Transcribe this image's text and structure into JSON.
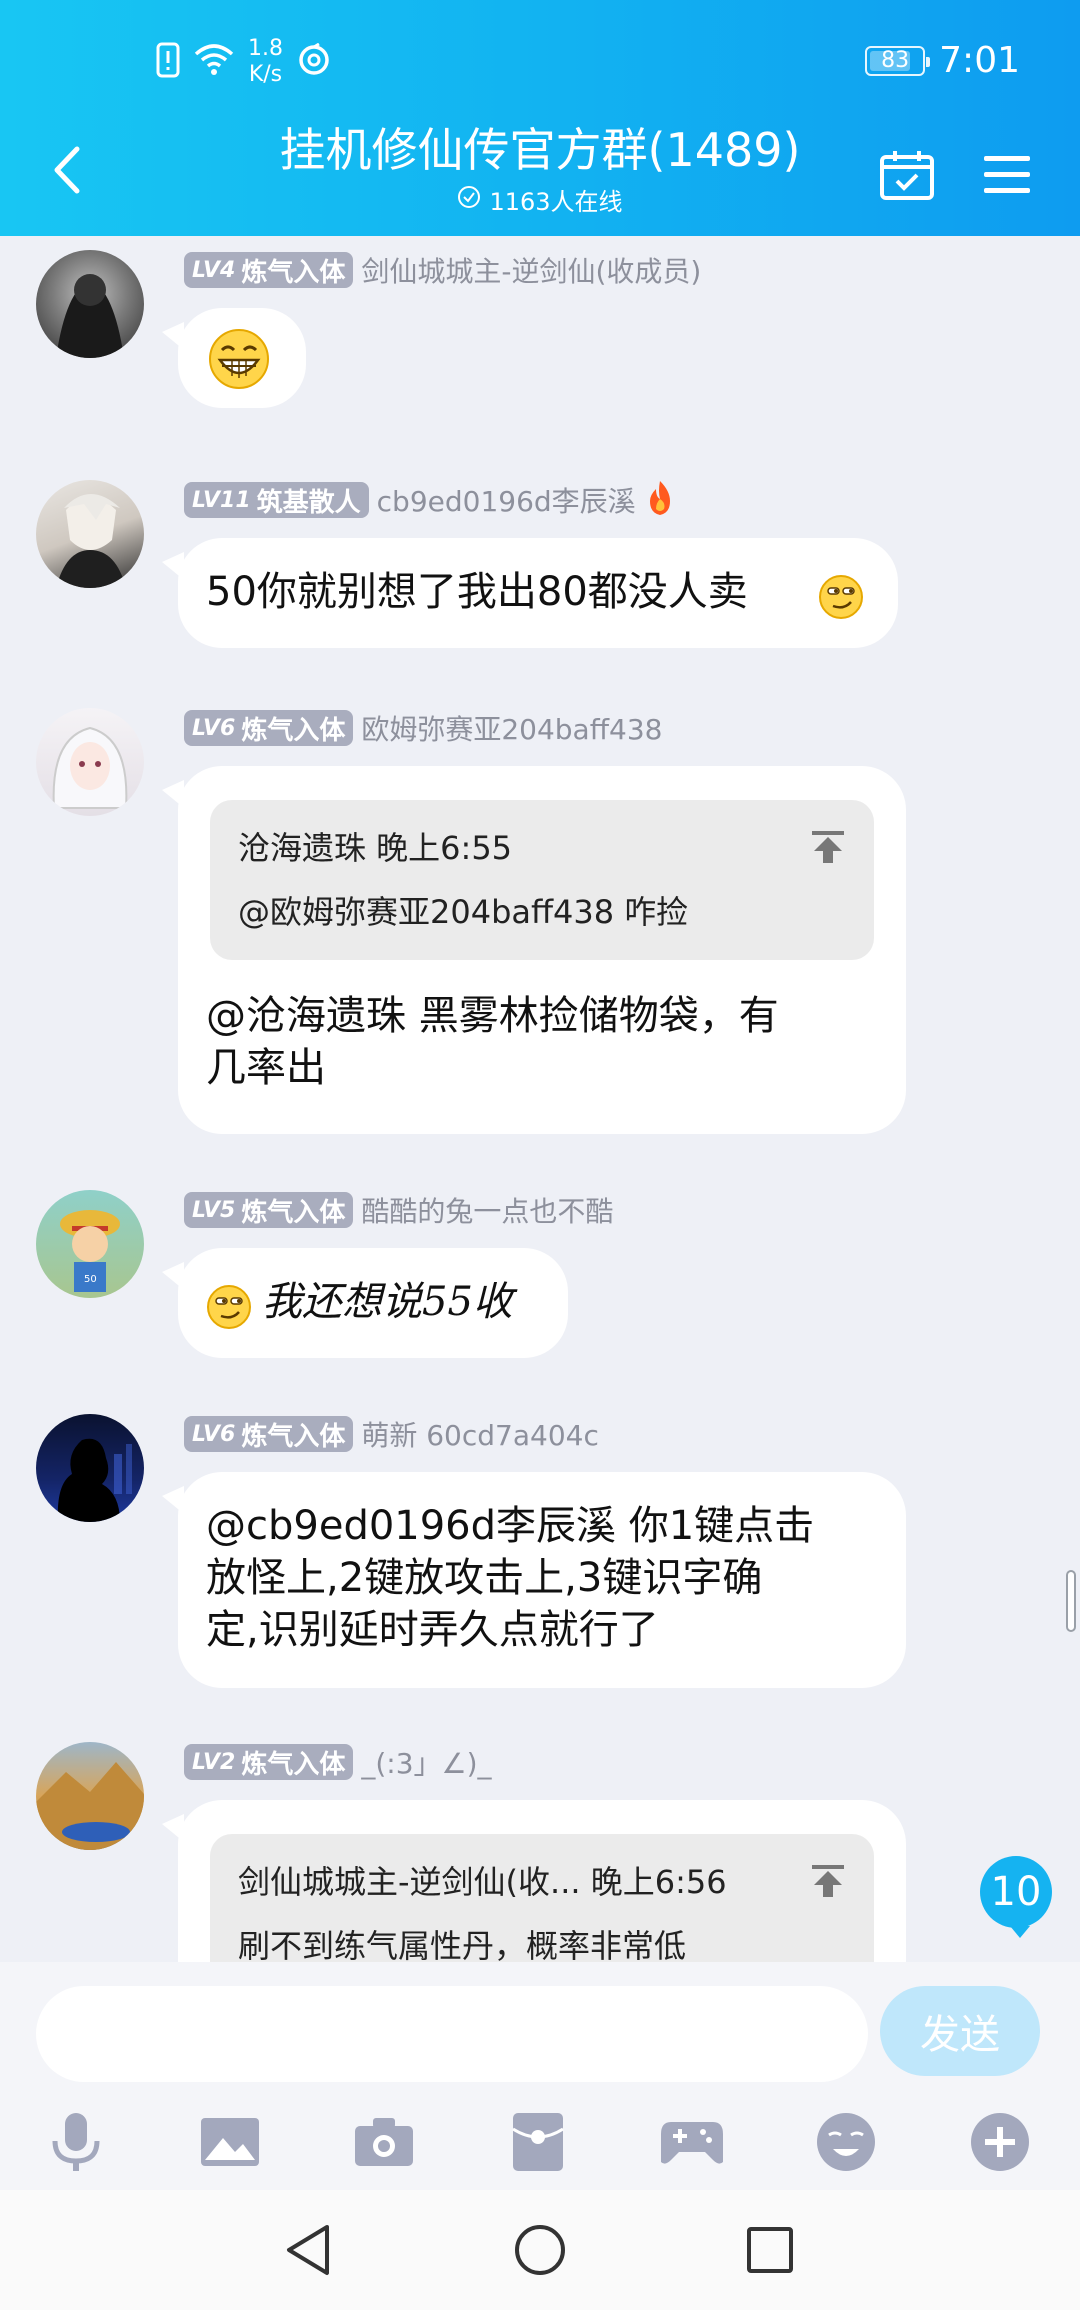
{
  "status_bar": {
    "speed_value": "1.8",
    "speed_unit": "K/s",
    "battery": "83",
    "time": "7:01"
  },
  "header": {
    "title": "挂机修仙传官方群(1489)",
    "online": "1163人在线"
  },
  "messages": [
    {
      "level": "LV4",
      "rank": "炼气入体",
      "nick": "剑仙城城主-逆剑仙(收成员)",
      "emoji": "grin-emoji"
    },
    {
      "level": "LV11",
      "rank": "筑基散人",
      "nick": "cb9ed0196d李辰溪",
      "text": "50你就别想了我出80都没人卖"
    },
    {
      "level": "LV6",
      "rank": "炼气入体",
      "nick": "欧姆弥赛亚204baff438",
      "quote_header": "沧海遗珠 晚上6:55",
      "quote_body": "@欧姆弥赛亚204baff438 咋捡",
      "text_line1": "@沧海遗珠 黑雾林捡储物袋，有",
      "text_line2": "几率出"
    },
    {
      "level": "LV5",
      "rank": "炼气入体",
      "nick": "酷酷的兔一点也不酷",
      "text": "我还想说55收"
    },
    {
      "level": "LV6",
      "rank": "炼气入体",
      "nick": "萌新 60cd7a404c",
      "text_line1": "@cb9ed0196d李辰溪 你1键点击",
      "text_line2": "放怪上,2键放攻击上,3键识字确",
      "text_line3": "定,识别延时弄久点就行了"
    },
    {
      "level": "LV2",
      "rank": "炼气入体",
      "nick": "_(:3」∠)_",
      "quote_header": "剑仙城城主-逆剑仙(收... 晚上6:56",
      "quote_body": "刷不到练气属性丹，概率非常低"
    }
  ],
  "unread_count": "10",
  "input": {
    "placeholder": "",
    "send_label": "发送"
  },
  "icons": [
    "microphone-icon",
    "image-icon",
    "camera-icon",
    "red-packet-icon",
    "gamepad-icon",
    "emoji-icon",
    "plus-icon"
  ],
  "colors": {
    "header_start": "#18c6f3",
    "header_end": "#0e9cf0",
    "badge": "#a9adbe",
    "send_disabled": "#bfe7fb"
  }
}
